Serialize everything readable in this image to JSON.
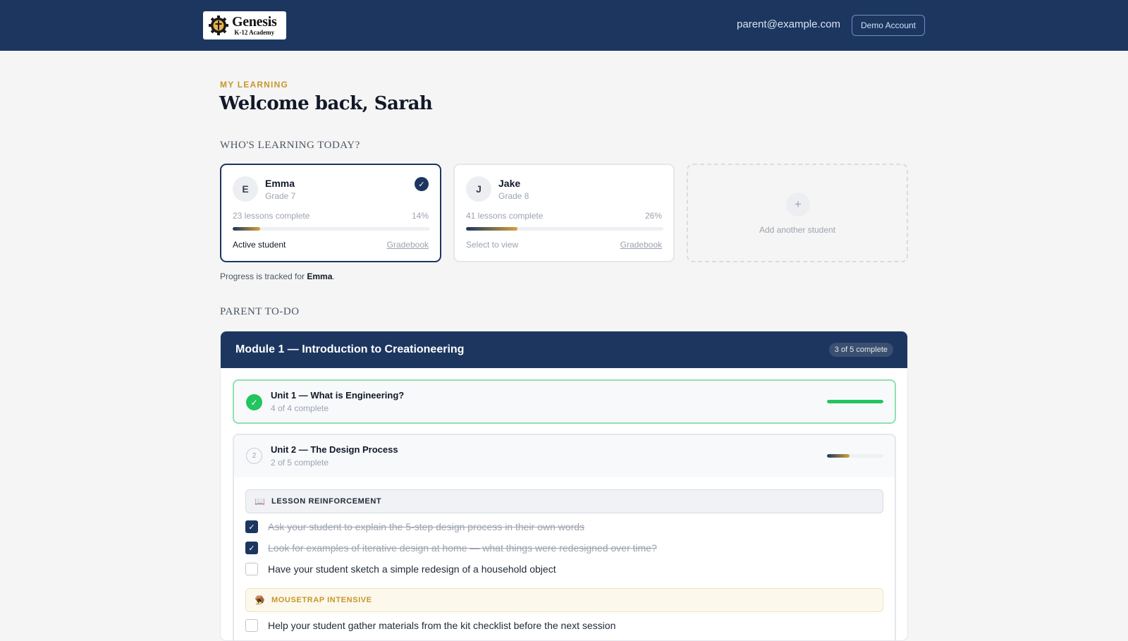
{
  "header": {
    "logo_title": "Genesis",
    "logo_subtitle": "K-12 Academy",
    "email": "parent@example.com",
    "demo_button": "Demo Account"
  },
  "page": {
    "eyebrow": "MY LEARNING",
    "welcome": "Welcome back, Sarah",
    "students_heading": "WHO'S LEARNING TODAY?",
    "todo_heading": "PARENT TO-DO"
  },
  "students": [
    {
      "initial": "E",
      "name": "Emma",
      "grade": "Grade 7",
      "lessons": "23 lessons complete",
      "percent_label": "14%",
      "progress": 14,
      "status": "Active student",
      "gradebook": "Gradebook"
    },
    {
      "initial": "J",
      "name": "Jake",
      "grade": "Grade 8",
      "lessons": "41 lessons complete",
      "percent_label": "26%",
      "progress": 26,
      "status": "Select to view",
      "gradebook": "Gradebook"
    }
  ],
  "add_student": {
    "icon": "+",
    "label": "Add another student"
  },
  "tracked": {
    "prefix": "Progress is tracked for ",
    "name": "Emma",
    "suffix": "."
  },
  "module": {
    "title": "Module 1 — Introduction to Creationeering",
    "count": "3 of 5 complete",
    "units": [
      {
        "number": "1",
        "title": "Unit 1 — What is Engineering?",
        "subtitle": "4 of 4 complete",
        "progress": 100
      },
      {
        "number": "2",
        "title": "Unit 2 — The Design Process",
        "subtitle": "2 of 5 complete",
        "progress": 40
      }
    ],
    "categories": [
      {
        "icon": "open-book-icon",
        "label": "LESSON REINFORCEMENT"
      },
      {
        "icon": "mousetrap-icon",
        "label": "MOUSETRAP INTENSIVE"
      }
    ],
    "tasks": [
      {
        "text": "Ask your student to explain the 5-step design process in their own words",
        "done": true
      },
      {
        "text": "Look for examples of iterative design at home — what things were redesigned over time?",
        "done": true
      },
      {
        "text": "Have your student sketch a simple redesign of a household object",
        "done": false
      },
      {
        "text": "Help your student gather materials from the kit checklist before the next session",
        "done": false
      }
    ]
  }
}
